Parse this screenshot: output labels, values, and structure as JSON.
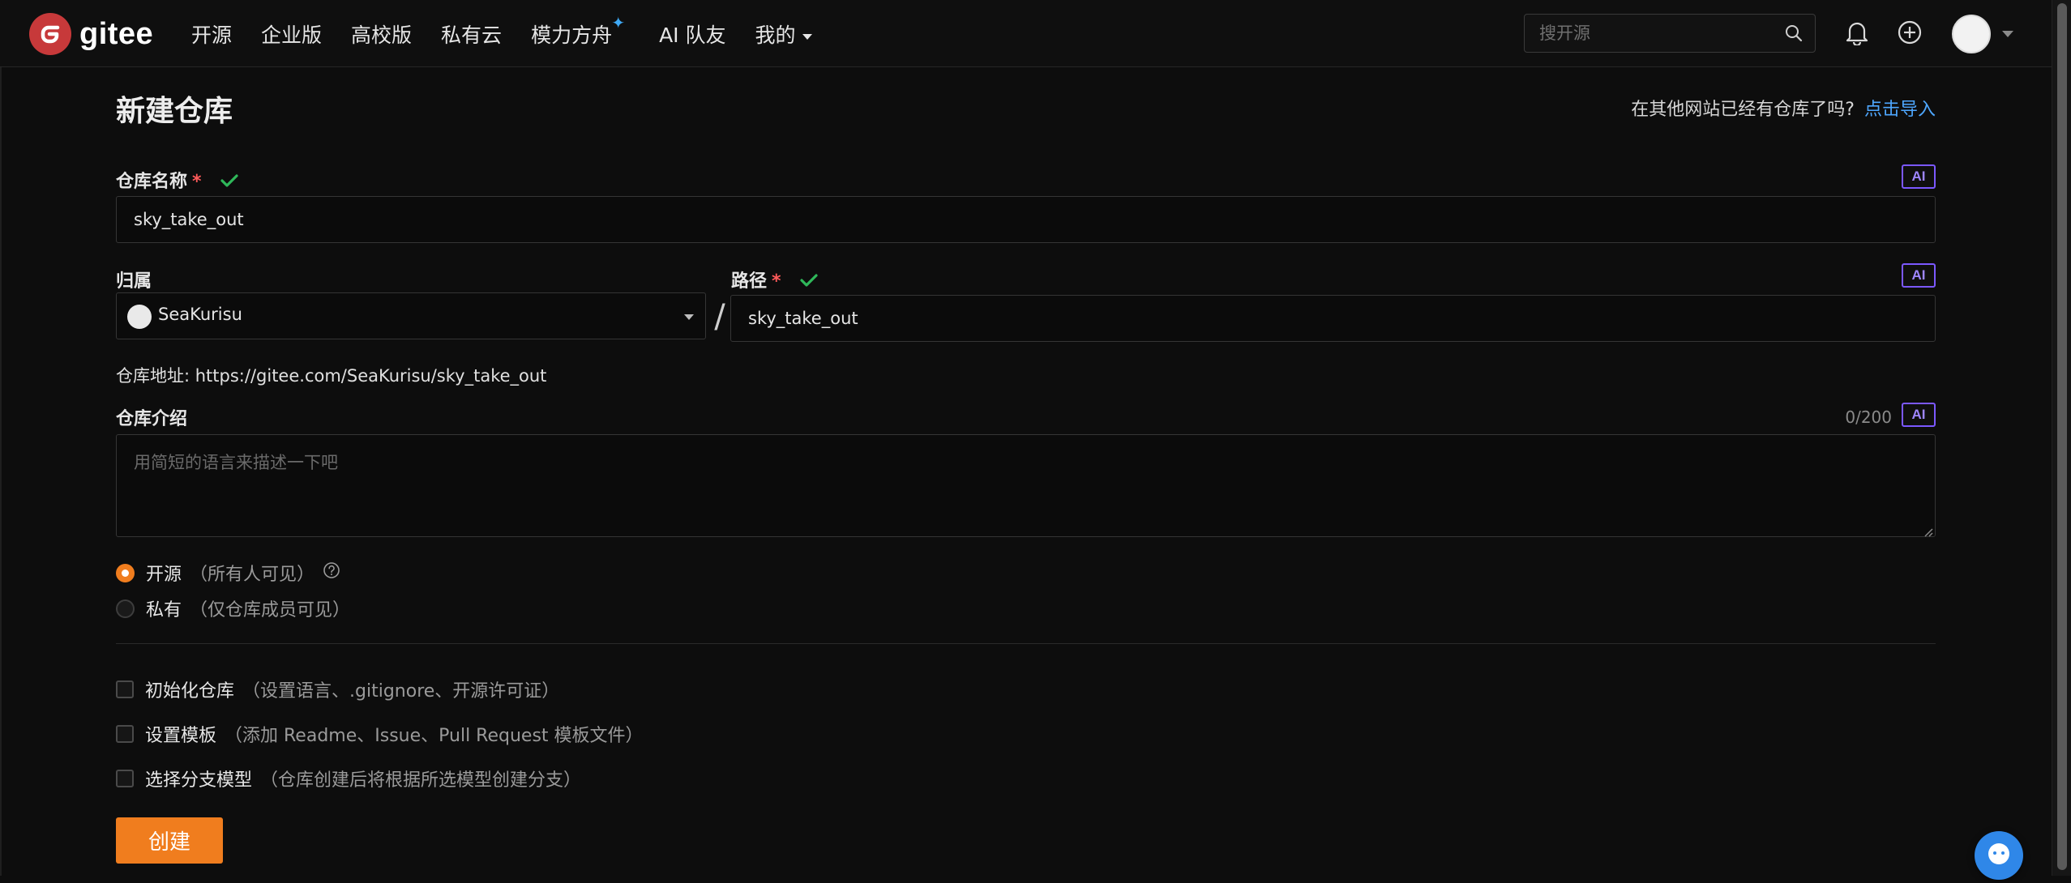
{
  "header": {
    "logo_text": "gitee",
    "nav": [
      "开源",
      "企业版",
      "高校版",
      "私有云",
      "模力方舟",
      "AI 队友",
      "我的"
    ],
    "search_placeholder": "搜开源"
  },
  "page": {
    "title": "新建仓库",
    "import_hint": "在其他网站已经有仓库了吗?",
    "import_link": "点击导入"
  },
  "form": {
    "name_label": "仓库名称",
    "required_mark": "*",
    "name_value": "sky_take_out",
    "owner_label": "归属",
    "owner_value": "SeaKurisu",
    "slash": "/",
    "path_label": "路径",
    "path_value": "sky_take_out",
    "ai_badge": "AI",
    "repo_url": "仓库地址: https://gitee.com/SeaKurisu/sky_take_out",
    "desc_label": "仓库介绍",
    "desc_count": "0/200",
    "desc_placeholder": "用简短的语言来描述一下吧",
    "visibility": [
      {
        "label": "开源",
        "hint": "（所有人可见）",
        "selected": true
      },
      {
        "label": "私有",
        "hint": "（仅仓库成员可见）",
        "selected": false
      }
    ],
    "options": [
      {
        "label": "初始化仓库",
        "hint": "（设置语言、.gitignore、开源许可证）"
      },
      {
        "label": "设置模板",
        "hint": "（添加 Readme、Issue、Pull Request 模板文件）"
      },
      {
        "label": "选择分支模型",
        "hint": "（仓库创建后将根据所选模型创建分支）"
      }
    ],
    "submit": "创建"
  },
  "colors": {
    "accent": "#f07d1e",
    "brand_red": "#c7393a",
    "link": "#4ea7ff",
    "ai_purple": "#7b58ff",
    "check_green": "#2fb85a"
  },
  "icons": [
    "gitee-logo-icon",
    "sparkle-icon",
    "search-icon",
    "bell-icon",
    "plus-circle-icon",
    "check-icon",
    "help-icon",
    "chevron-down-icon",
    "chat-help-icon"
  ]
}
